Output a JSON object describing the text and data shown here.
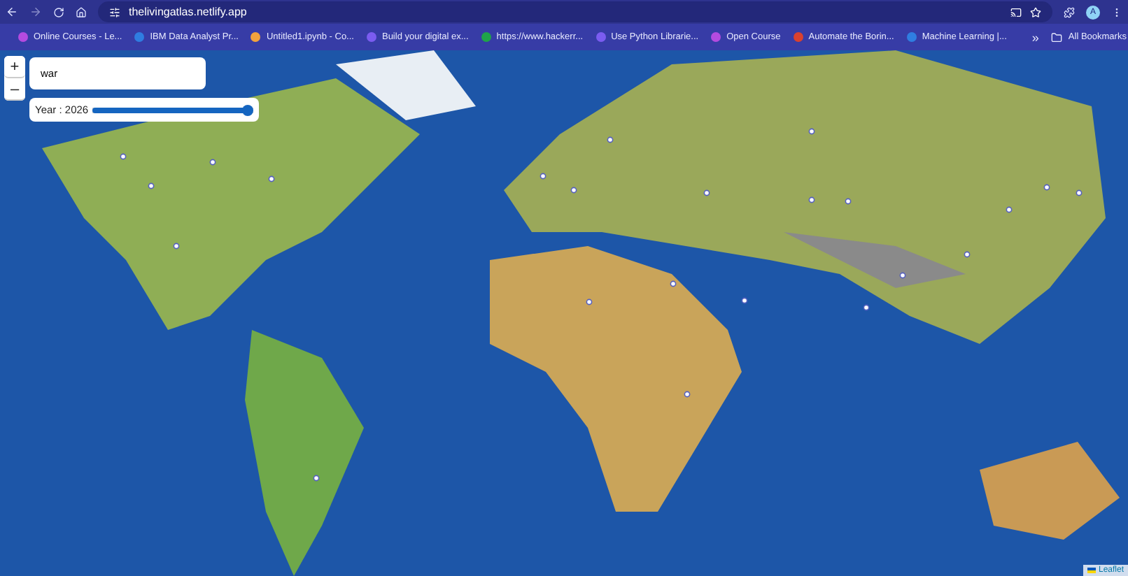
{
  "browser": {
    "url": "thelivingatlas.netlify.app"
  },
  "bookmarks": [
    {
      "label": "Online Courses - Le...",
      "color": "#b44be0"
    },
    {
      "label": "IBM Data Analyst Pr...",
      "color": "#2f7de1"
    },
    {
      "label": "Untitled1.ipynb - Co...",
      "color": "#f2a23c"
    },
    {
      "label": "Build your digital ex...",
      "color": "#7b5cf0"
    },
    {
      "label": "https://www.hackerr...",
      "color": "#1fa34a"
    },
    {
      "label": "Use Python Librarie...",
      "color": "#7b5cf0"
    },
    {
      "label": "Open Course",
      "color": "#b44be0"
    },
    {
      "label": "Automate the Borin...",
      "color": "#d9412f"
    },
    {
      "label": "Machine Learning |...",
      "color": "#2f7de1"
    }
  ],
  "more_bookmarks": "»",
  "all_bookmarks": "All Bookmarks",
  "profile_initial": "A",
  "map": {
    "zoom_in": "+",
    "zoom_out": "–",
    "search": {
      "value": "war"
    },
    "year": {
      "label": "Year : 2026",
      "level": 1
    },
    "attribution": "Leaflet"
  }
}
